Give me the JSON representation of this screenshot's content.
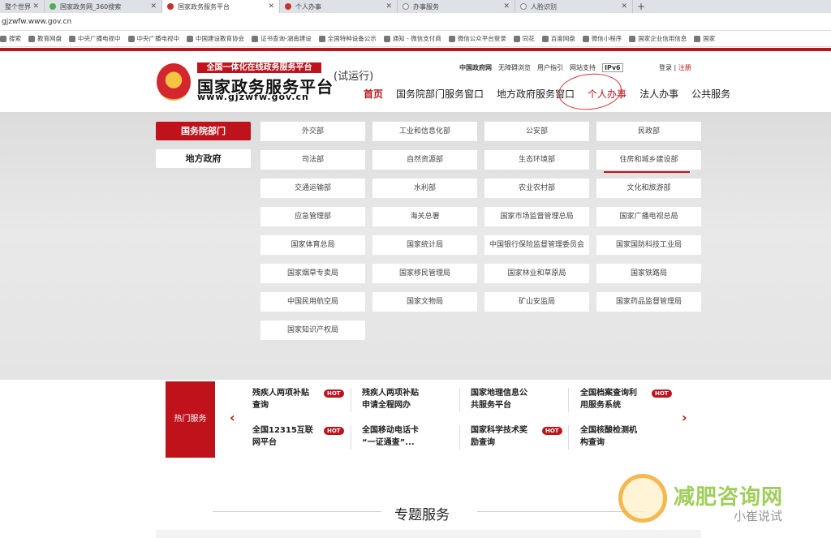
{
  "browser": {
    "tabs": [
      {
        "title": "整个世界"
      },
      {
        "title": "国家政务网_360搜索"
      },
      {
        "title": "国家政务服务平台"
      },
      {
        "title": "个人办事"
      },
      {
        "title": "办事服务"
      },
      {
        "title": "人脸识别"
      }
    ],
    "new_tab": "+",
    "url": "gjzwfw.www.gov.cn",
    "bookmarks": [
      "搜索",
      "教育网盘",
      "中央广播电视中",
      "中央广播电视中",
      "中国建设教育协会",
      "证书查询-湖南建设",
      "全国特种设备公示",
      "通知 - 微信支付商",
      "微信公众平台登录",
      "同花",
      "百度网盘",
      "微信小程序",
      "国家企业信用信息",
      "国家"
    ]
  },
  "header": {
    "banner": "全国一体化在线政务服务平台",
    "title": "国家政务服务平台",
    "url": "www.gjzwfw.gov.cn",
    "trial": "(试运行)",
    "toplinks": [
      "中国政府网",
      "无障碍浏览",
      "用户指引",
      "网站支持"
    ],
    "ipv6": "IPv6",
    "login": "登录",
    "sep": "|",
    "register": "注册",
    "nav": [
      "首页",
      "国务院部门服务窗口",
      "地方政府服务窗口",
      "个人办事",
      "法人办事",
      "公共服务"
    ]
  },
  "side": {
    "active": "国务院部门",
    "other": "地方政府"
  },
  "departments": [
    "外交部",
    "工业和信息化部",
    "公安部",
    "民政部",
    "司法部",
    "自然资源部",
    "生态环境部",
    "住房和城乡建设部",
    "交通运输部",
    "水利部",
    "农业农村部",
    "文化和旅游部",
    "应急管理部",
    "海关总署",
    "国家市场监督管理总局",
    "国家广播电视总局",
    "国家体育总局",
    "国家统计局",
    "中国银行保险监督管理委员会",
    "国家国防科技工业局",
    "国家烟草专卖局",
    "国家移民管理局",
    "国家林业和草原局",
    "国家铁路局",
    "中国民用航空局",
    "国家文物局",
    "矿山安监局",
    "国家药品监督管理局",
    "国家知识产权局"
  ],
  "hot": {
    "label": "热门服务",
    "hot_badge": "HOT",
    "prev": "‹",
    "next": "›",
    "items": [
      {
        "l1": "残疾人两项补贴",
        "l2": "查询",
        "hot": true
      },
      {
        "l1": "残疾人两项补贴",
        "l2": "申请全程网办",
        "hot": false
      },
      {
        "l1": "国家地理信息公",
        "l2": "共服务平台",
        "hot": false
      },
      {
        "l1": "全国档案查询利",
        "l2": "用服务系统",
        "hot": true
      },
      {
        "l1": "全国12315互联",
        "l2": "网平台",
        "hot": true
      },
      {
        "l1": "全国移动电话卡",
        "l2": "“一证通查”...",
        "hot": false
      },
      {
        "l1": "国家科学技术奖",
        "l2": "励查询",
        "hot": true
      },
      {
        "l1": "全国核酸检测机",
        "l2": "构查询",
        "hot": false
      }
    ]
  },
  "section": {
    "title": "专题服务"
  },
  "watermark": {
    "text": "减肥咨询网",
    "sub": "小崔说试"
  },
  "colors": {
    "brand": "#c0121b",
    "watermark": "#8fc63f"
  }
}
